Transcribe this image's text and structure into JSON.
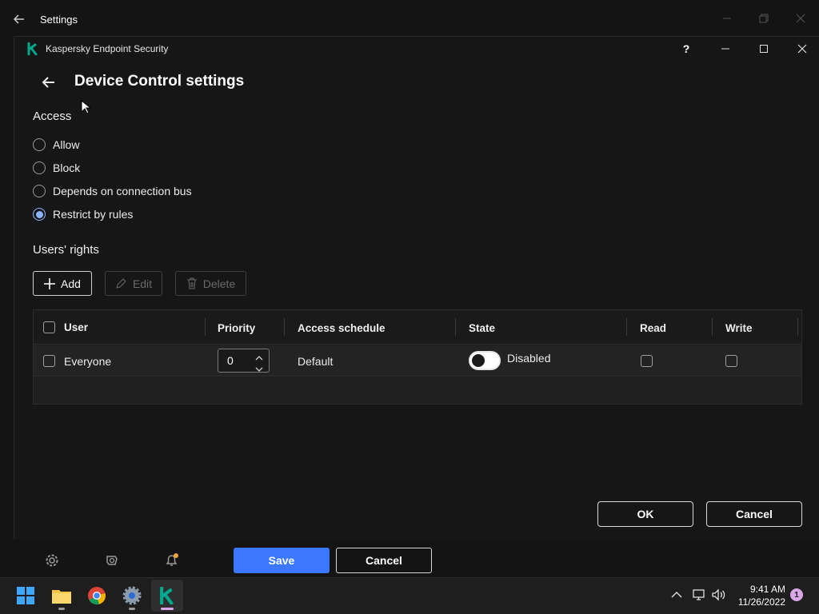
{
  "outer_window": {
    "title": "Settings"
  },
  "app_window": {
    "title": "Kaspersky Endpoint Security",
    "help": "?"
  },
  "page": {
    "title": "Device Control settings"
  },
  "access": {
    "heading": "Access",
    "options": [
      {
        "label": "Allow",
        "checked": false
      },
      {
        "label": "Block",
        "checked": false
      },
      {
        "label": "Depends on connection bus",
        "checked": false
      },
      {
        "label": "Restrict by rules",
        "checked": true
      }
    ]
  },
  "users_rights": {
    "heading": "Users' rights",
    "toolbar": {
      "add": "Add",
      "edit": "Edit",
      "delete": "Delete"
    },
    "columns": [
      "User",
      "Priority",
      "Access schedule",
      "State",
      "Read",
      "Write"
    ],
    "rows": [
      {
        "user": "Everyone",
        "priority": "0",
        "schedule": "Default",
        "state": "Disabled",
        "read": false,
        "write": false
      }
    ]
  },
  "dialog": {
    "ok": "OK",
    "cancel": "Cancel"
  },
  "settings_bar": {
    "save": "Save",
    "cancel": "Cancel"
  },
  "taskbar": {
    "time": "9:41 AM",
    "date": "11/26/2022",
    "notification_count": "1",
    "apps": [
      "start-icon",
      "file-explorer-icon",
      "chrome-icon",
      "settings-app-icon",
      "kaspersky-app-icon"
    ]
  },
  "colors": {
    "accent": "#3b78ff",
    "radio_checked": "#8ab4ff",
    "kaspersky_green": "#00a88e"
  }
}
